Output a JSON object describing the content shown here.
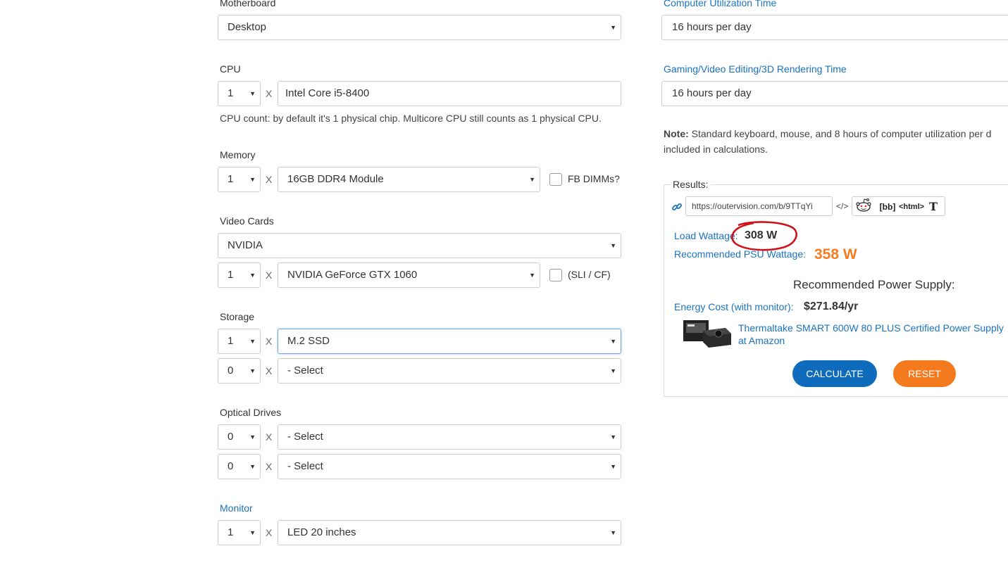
{
  "left": {
    "motherboard": {
      "label": "Motherboard",
      "value": "Desktop"
    },
    "cpu": {
      "label": "CPU",
      "count": "1",
      "value": "Intel Core i5-8400",
      "hint": "CPU count: by default it's 1 physical chip. Multicore CPU still counts as 1 physical CPU."
    },
    "memory": {
      "label": "Memory",
      "count": "1",
      "value": "16GB DDR4 Module",
      "checkbox_label": "FB DIMMs?"
    },
    "video": {
      "label": "Video Cards",
      "brand": "NVIDIA",
      "count": "1",
      "value": "NVIDIA GeForce GTX 1060",
      "checkbox_label": "(SLI / CF)"
    },
    "storage": {
      "label": "Storage",
      "rows": [
        {
          "count": "1",
          "value": "M.2 SSD"
        },
        {
          "count": "0",
          "value": "- Select"
        }
      ]
    },
    "optical": {
      "label": "Optical Drives",
      "rows": [
        {
          "count": "0",
          "value": "- Select"
        },
        {
          "count": "0",
          "value": "- Select"
        }
      ]
    },
    "monitor": {
      "label": "Monitor",
      "count": "1",
      "value": "LED 20 inches"
    },
    "x_sep": "X"
  },
  "right": {
    "util": {
      "label": "Computer Utilization Time",
      "value": "16 hours per day"
    },
    "gaming": {
      "label": "Gaming/Video Editing/3D Rendering Time",
      "value": "16 hours per day"
    },
    "note_bold": "Note:",
    "note_line1": " Standard keyboard, mouse, and 8 hours of computer utilization per d",
    "note_line2": "included in calculations.",
    "results": {
      "legend": "Results:",
      "share_url": "https://outervision.com/b/9TTqYi",
      "share_buttons": {
        "embed": "</>",
        "bb": "[bb]",
        "html": "<html>",
        "text": "T"
      },
      "load_label": "Load Wattage:",
      "load_value": "308 W",
      "psu_label": "Recommended PSU Wattage:",
      "psu_value": "358 W",
      "rec_title": "Recommended Power Supply:",
      "energy_label": "Energy Cost (with monitor):",
      "energy_value": "$271.84/yr",
      "product_line1": "Thermaltake SMART 600W 80 PLUS Certified Power Supply",
      "product_line2": "at Amazon",
      "calc_label": "CALCULATE",
      "reset_label": "RESET"
    }
  },
  "colors": {
    "accent_blue": "#1a73c2",
    "orange": "#f57c1f",
    "calc_btn": "#0f6cbd",
    "reset_btn": "#f57a1e",
    "annotation_red": "#d0121b"
  }
}
